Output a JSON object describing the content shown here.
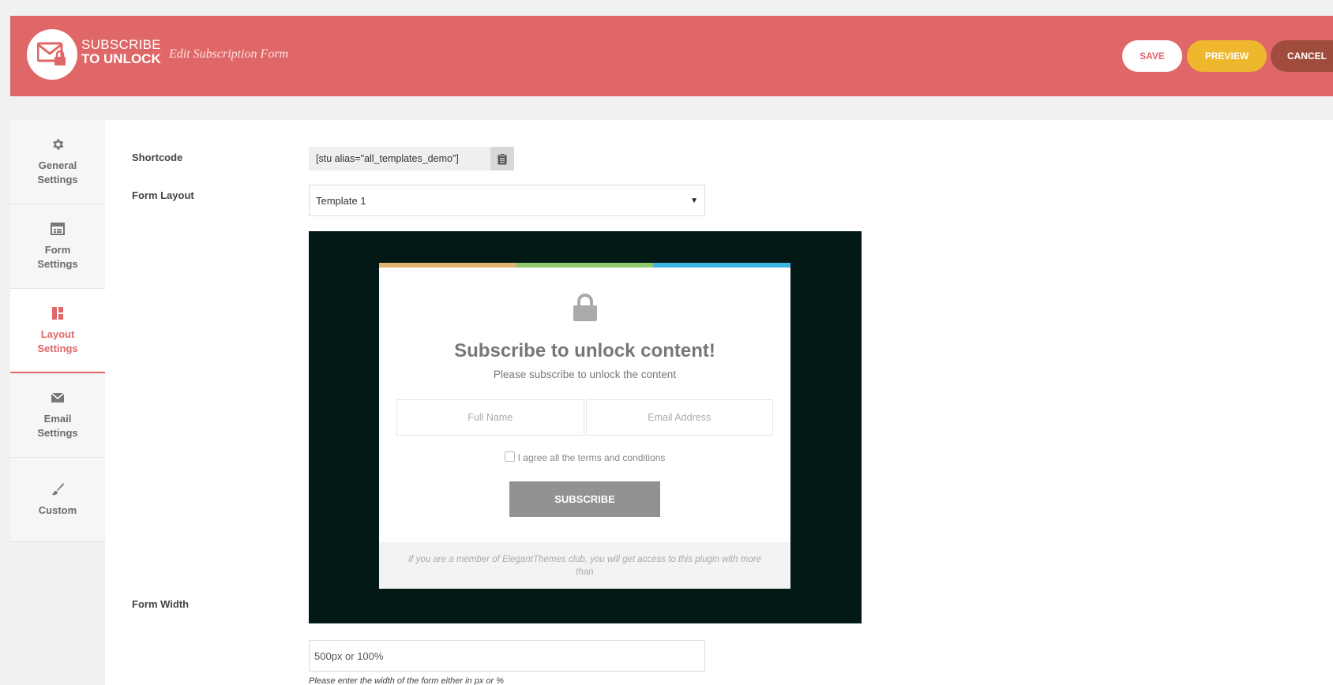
{
  "header": {
    "brand_line1": "SUBSCRIBE",
    "brand_line2": "TO UNLOCK",
    "title": "Edit Subscription Form",
    "save_label": "SAVE",
    "preview_label": "PREVIEW",
    "cancel_label": "CANCEL"
  },
  "sidebar": {
    "items": [
      {
        "label1": "General",
        "label2": "Settings",
        "icon": "gear-icon"
      },
      {
        "label1": "Form",
        "label2": "Settings",
        "icon": "form-icon"
      },
      {
        "label1": "Layout",
        "label2": "Settings",
        "icon": "layout-icon"
      },
      {
        "label1": "Email",
        "label2": "Settings",
        "icon": "envelope-icon"
      },
      {
        "label1": "Custom",
        "label2": "",
        "icon": "brush-icon"
      }
    ],
    "active_index": 2
  },
  "form": {
    "shortcode_label": "Shortcode",
    "shortcode_value": "[stu alias=\"all_templates_demo\"]",
    "layout_label": "Form Layout",
    "layout_value": "Template 1",
    "width_label": "Form Width",
    "width_placeholder": "500px or 100%",
    "width_help": "Please enter the width of the form either in px or %"
  },
  "preview": {
    "title": "Subscribe to unlock content!",
    "subtitle": "Please subscribe to unlock the content",
    "name_placeholder": "Full Name",
    "email_placeholder": "Email Address",
    "agree_text": "I agree all the terms and conditions",
    "button": "SUBSCRIBE",
    "footer": "If you are a member of ElegantThemes club, you will get access to this plugin with more than"
  },
  "colors": {
    "accent": "#e06767",
    "preview_bg": "#031915",
    "stripe1": "#e3b46f",
    "stripe2": "#90c96e",
    "stripe3": "#39b5e6"
  }
}
